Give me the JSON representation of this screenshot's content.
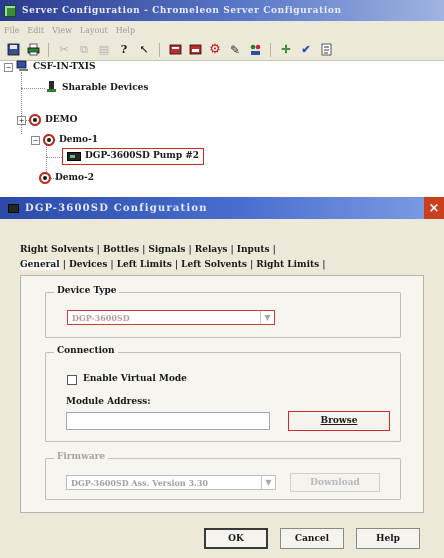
{
  "server_window": {
    "title": "Server Configuration - Chromeleon Server Configuration",
    "menu": [
      "File",
      "Edit",
      "View",
      "Layout",
      "Help"
    ],
    "toolbar_icons": [
      "disk-icon",
      "printer-icon",
      "cut-icon",
      "copy-icon",
      "paste-icon",
      "help-icon",
      "whatsthis-icon",
      "server-red-icon",
      "server-green-icon",
      "wrench-icon",
      "pen-icon",
      "group-icon",
      "cross-icon",
      "check-icon",
      "settings-icon"
    ]
  },
  "tree": {
    "root": "CSF-IN-TXIS",
    "items": [
      {
        "label": "Sharable Devices"
      },
      {
        "label": "DEMO",
        "expander": "+"
      },
      {
        "label": "Demo-1",
        "expander": "−"
      },
      {
        "label": "DGP-3600SD Pump #2"
      },
      {
        "label": "Demo-2"
      }
    ]
  },
  "dialog": {
    "title": "DGP-3600SD Configuration",
    "close_glyph": "×",
    "tabs_row1": [
      "Right Solvents",
      "Bottles",
      "Signals",
      "Relays",
      "Inputs"
    ],
    "tabs_row2": [
      "General",
      "Devices",
      "Left Limits",
      "Left Solvents",
      "Right Limits"
    ],
    "device_type": {
      "label": "Device Type",
      "value": "DGP-3600SD"
    },
    "connection": {
      "label": "Connection",
      "virtual_mode_label": "Enable Virtual Mode",
      "virtual_mode_checked": false,
      "module_address_label": "Module Address:",
      "module_address_value": "",
      "browse_label": "Browse"
    },
    "firmware": {
      "label": "Firmware",
      "version_value": "DGP-3600SD Ass. Version 3.30",
      "download_label": "Download"
    },
    "buttons": {
      "ok": "OK",
      "cancel": "Cancel",
      "help": "Help"
    }
  }
}
